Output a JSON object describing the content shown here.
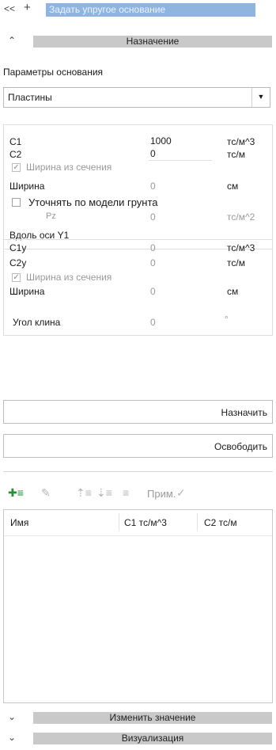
{
  "titlebar": {
    "back_glyph": "<<",
    "pin_glyph": "+",
    "title": "Задать упругое основание"
  },
  "section_assign": {
    "title": "Назначение",
    "chevron": "⌃"
  },
  "params_label": "Параметры основания",
  "base_type": {
    "selected": "Пластины"
  },
  "c1": {
    "label": "C1",
    "value": "1000",
    "unit": "тс/м^3"
  },
  "c2": {
    "label": "C2",
    "value": "0",
    "unit": "тс/м"
  },
  "width_from_section": {
    "label": "Ширина из сечения",
    "checked": true
  },
  "width": {
    "label": "Ширина",
    "value": "0",
    "unit": "см"
  },
  "refine_soil": {
    "label": "Уточнять по модели грунта",
    "checked": false
  },
  "pz": {
    "label": "Pz",
    "value": "0",
    "unit": "тс/м^2"
  },
  "along_y1": {
    "title": "Вдоль оси Y1",
    "c1y": {
      "label": "C1y",
      "value": "0",
      "unit": "тс/м^3"
    },
    "c2y": {
      "label": "C2y",
      "value": "0",
      "unit": "тс/м"
    },
    "width_from_section": {
      "label": "Ширина из сечения",
      "checked": true
    },
    "width": {
      "label": "Ширина",
      "value": "0",
      "unit": "см"
    }
  },
  "wedge_angle": {
    "label": "Угол клина",
    "value": "0",
    "unit": "°"
  },
  "buttons": {
    "assign": "Назначить",
    "release": "Освободить"
  },
  "toolbar": {
    "apply_label": "Прим."
  },
  "table": {
    "columns": [
      "Имя",
      "C1 тс/м^3",
      "C2 тс/м"
    ],
    "rows": []
  },
  "section_change": {
    "title": "Изменить значение",
    "chevron": "⌄"
  },
  "section_visual": {
    "title": "Визуализация",
    "chevron": "⌄"
  }
}
